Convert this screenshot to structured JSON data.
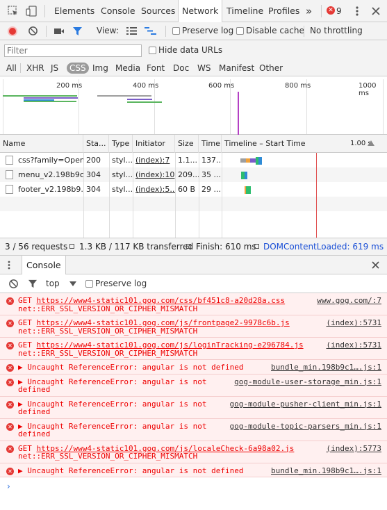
{
  "tabs": [
    "Elements",
    "Console",
    "Sources",
    "Network",
    "Timeline",
    "Profiles"
  ],
  "active_tab": "Network",
  "more_tabs": "»",
  "error_count": "9",
  "network_toolbar": {
    "view_label": "View:",
    "preserve_log": "Preserve log",
    "disable_cache": "Disable cache",
    "throttling": "No throttling"
  },
  "filter": {
    "placeholder": "Filter",
    "hide_data_urls": "Hide data URLs",
    "types": [
      "All",
      "XHR",
      "JS",
      "CSS",
      "Img",
      "Media",
      "Font",
      "Doc",
      "WS",
      "Manifest",
      "Other"
    ],
    "selected_type": "CSS"
  },
  "overview": {
    "ticks": [
      "200 ms",
      "400 ms",
      "600 ms",
      "800 ms",
      "1000 ms"
    ]
  },
  "table": {
    "headers": [
      "Name",
      "Sta...",
      "Type",
      "Initiator",
      "Size",
      "Time",
      "Timeline – Start Time",
      "1.00 s"
    ],
    "rows": [
      {
        "name": "css?family=Open...",
        "status": "200",
        "type": "styl...",
        "initiator": "(index):7",
        "size": "1.1...",
        "time": "137..."
      },
      {
        "name": "menu_v2.198b9c...",
        "status": "304",
        "type": "styl...",
        "initiator": "(index):10",
        "size": "209...",
        "time": "35 ..."
      },
      {
        "name": "footer_v2.198b9...",
        "status": "304",
        "type": "styl...",
        "initiator": "(index):5...",
        "size": "60 B",
        "time": "29 ..."
      }
    ]
  },
  "summary": {
    "requests": "3 / 56 requests",
    "transferred": "1.3 KB / 117 KB transferred",
    "finish": "Finish: 610 ms",
    "dcl": "DOMContentLoaded: 619 ms"
  },
  "console": {
    "tab": "Console",
    "context": "top",
    "preserve_log": "Preserve log",
    "messages": [
      {
        "pre": "GET ",
        "link": "https://www4-static101.gog.com/css/bf451c8-a20d28a.css",
        "post": " net::ERR_SSL_VERSION_OR_CIPHER_MISMATCH",
        "src": "www.gog.com/:7"
      },
      {
        "pre": "GET ",
        "link": "https://www4-static101.gog.com/js/frontpage2-9978c6b.js",
        "post": " net::ERR_SSL_VERSION_OR_CIPHER_MISMATCH",
        "src": "(index):5731"
      },
      {
        "pre": "GET ",
        "link": "https://www4-static101.gog.com/js/loginTracking-e296784.js",
        "post": " net::ERR_SSL_VERSION_OR_CIPHER_MISMATCH",
        "src": "(index):5731"
      },
      {
        "pre": "▶ Uncaught ReferenceError: angular is not defined",
        "link": "",
        "post": "",
        "src": "bundle_min.198b9c1….js:1"
      },
      {
        "pre": "▶ Uncaught ReferenceError: angular is not defined",
        "link": "",
        "post": "",
        "src": "gog-module-user-storage_min.js:1"
      },
      {
        "pre": "▶ Uncaught ReferenceError: angular is not defined",
        "link": "",
        "post": "",
        "src": "gog-module-pusher-client_min.js:1"
      },
      {
        "pre": "▶ Uncaught ReferenceError: angular is not defined",
        "link": "",
        "post": "",
        "src": "gog-module-topic-parsers_min.js:1"
      },
      {
        "pre": "GET ",
        "link": "https://www4-static101.gog.com/js/localeCheck-6a98a02.js",
        "post": " net::ERR_SSL_VERSION_OR_CIPHER_MISMATCH",
        "src": "(index):5773"
      },
      {
        "pre": "▶ Uncaught ReferenceError: angular is not defined",
        "link": "",
        "post": "",
        "src": "bundle_min.198b9c1….js:1"
      }
    ],
    "prompt": "›"
  }
}
